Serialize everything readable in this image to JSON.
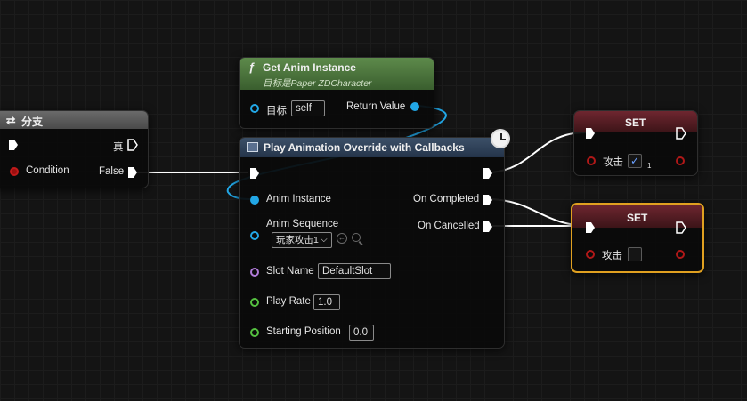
{
  "branch_node": {
    "title": "分支",
    "condition_label": "Condition",
    "true_label": "真",
    "false_label": "False"
  },
  "get_anim_node": {
    "title": "Get Anim Instance",
    "subtitle": "目标是Paper ZDCharacter",
    "target_label": "目标",
    "target_value": "self",
    "return_label": "Return Value"
  },
  "play_node": {
    "title": "Play Animation Override with Callbacks",
    "anim_instance_label": "Anim Instance",
    "anim_sequence_label": "Anim Sequence",
    "anim_sequence_value": "玩家攻击1",
    "slot_name_label": "Slot Name",
    "slot_name_value": "DefaultSlot",
    "play_rate_label": "Play Rate",
    "play_rate_value": "1.0",
    "starting_position_label": "Starting Position",
    "starting_position_value": "0.0",
    "on_completed_label": "On Completed",
    "on_cancelled_label": "On Cancelled"
  },
  "set_node_1": {
    "title": "SET",
    "var_label": "攻击",
    "checked": "✓",
    "output_value": "1"
  },
  "set_node_2": {
    "title": "SET",
    "var_label": "攻击"
  },
  "colors": {
    "exec": "#ffffff",
    "object_pin": "#22a7e6",
    "bool_pin": "#b01818",
    "name_pin": "#b07ad8",
    "float_pin": "#55c040",
    "function_header": "#4d7a3f",
    "set_header": "#5a1a22",
    "selection": "#e0a020"
  }
}
